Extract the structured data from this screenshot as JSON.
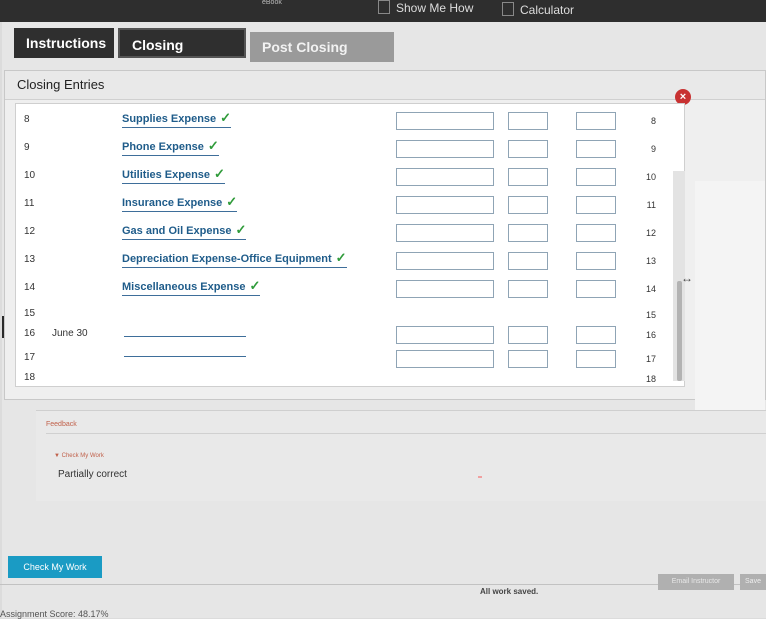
{
  "topbar": {
    "ebook_label": "eBook",
    "show_me_how_label": "Show Me How",
    "calculator_label": "Calculator"
  },
  "tabs": [
    {
      "label": "Instructions"
    },
    {
      "label": "Closing Entries"
    },
    {
      "label": "Post Closing Entries"
    }
  ],
  "content": {
    "title": "Closing Entries",
    "rows": [
      {
        "num": "8",
        "date": "",
        "account": "Supplies Expense",
        "check": "✓",
        "right_num": "8"
      },
      {
        "num": "9",
        "date": "",
        "account": "Phone Expense",
        "check": "✓",
        "right_num": "9"
      },
      {
        "num": "10",
        "date": "",
        "account": "Utilities Expense",
        "check": "✓",
        "right_num": "10"
      },
      {
        "num": "11",
        "date": "",
        "account": "Insurance Expense",
        "check": "✓",
        "right_num": "11"
      },
      {
        "num": "12",
        "date": "",
        "account": "Gas and Oil Expense",
        "check": "✓",
        "right_num": "12"
      },
      {
        "num": "13",
        "date": "",
        "account": "Depreciation Expense-Office Equipment",
        "check": "✓",
        "right_num": "13"
      },
      {
        "num": "14",
        "date": "",
        "account": "Miscellaneous Expense",
        "check": "✓",
        "right_num": "14"
      },
      {
        "num": "15",
        "date": "",
        "account": "",
        "check": "",
        "right_num": "15"
      },
      {
        "num": "16",
        "date": "June 30",
        "account": "",
        "check": "",
        "right_num": "16"
      },
      {
        "num": "17",
        "date": "",
        "account": "",
        "check": "",
        "right_num": "17"
      },
      {
        "num": "18",
        "date": "",
        "account": "",
        "check": "",
        "right_num": "18"
      }
    ]
  },
  "feedback": {
    "title": "Feedback",
    "check_link": "▼ Check My Work",
    "result": "Partially correct"
  },
  "footer": {
    "check_button": "Check My Work",
    "saved_text": "All work saved.",
    "email_button": "Email Instructor",
    "save_button": "Save",
    "score_text": "Assignment Score: 48.17%"
  }
}
